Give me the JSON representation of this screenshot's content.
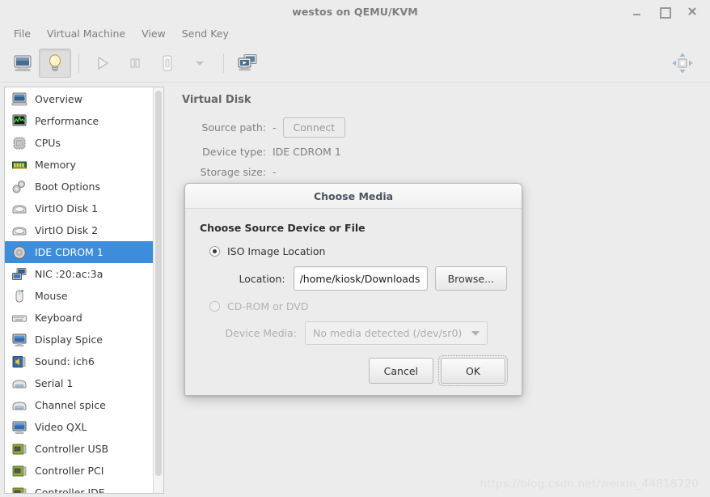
{
  "window": {
    "title": "westos on QEMU/KVM",
    "buttons": {
      "minimize": "–",
      "maximize": "□",
      "close": "✕"
    }
  },
  "menubar": {
    "items": [
      {
        "label": "File",
        "name": "menu-file"
      },
      {
        "label": "Virtual Machine",
        "name": "menu-virtual-machine"
      },
      {
        "label": "View",
        "name": "menu-view"
      },
      {
        "label": "Send Key",
        "name": "menu-send-key"
      }
    ]
  },
  "toolbar": {
    "buttons": [
      {
        "name": "show-console-button",
        "icon": "monitor-icon",
        "pressed": false
      },
      {
        "name": "show-details-button",
        "icon": "lightbulb-icon",
        "pressed": true
      },
      {
        "name": "run-button",
        "icon": "play-icon",
        "pressed": false
      },
      {
        "name": "pause-button",
        "icon": "pause-icon",
        "pressed": false
      },
      {
        "name": "shutdown-button",
        "icon": "power-icon",
        "pressed": false
      },
      {
        "name": "shutdown-menu-button",
        "icon": "chevron-down-icon",
        "pressed": false
      },
      {
        "name": "snapshots-button",
        "icon": "screens-icon",
        "pressed": false
      }
    ],
    "right_button": {
      "name": "fullscreen-button",
      "icon": "resize-icon"
    }
  },
  "sidebar": {
    "selected_index": 7,
    "items": [
      {
        "label": "Overview",
        "icon": "computer-icon"
      },
      {
        "label": "Performance",
        "icon": "chart-monitor-icon"
      },
      {
        "label": "CPUs",
        "icon": "cpu-chip-icon"
      },
      {
        "label": "Memory",
        "icon": "memory-stick-icon"
      },
      {
        "label": "Boot Options",
        "icon": "gears-icon"
      },
      {
        "label": "VirtIO Disk 1",
        "icon": "hard-disk-icon"
      },
      {
        "label": "VirtIO Disk 2",
        "icon": "hard-disk-icon"
      },
      {
        "label": "IDE CDROM 1",
        "icon": "cdrom-disc-icon"
      },
      {
        "label": "NIC :20:ac:3a",
        "icon": "network-icon"
      },
      {
        "label": "Mouse",
        "icon": "mouse-icon"
      },
      {
        "label": "Keyboard",
        "icon": "keyboard-icon"
      },
      {
        "label": "Display Spice",
        "icon": "display-icon"
      },
      {
        "label": "Sound: ich6",
        "icon": "sound-card-icon"
      },
      {
        "label": "Serial 1",
        "icon": "serial-port-icon"
      },
      {
        "label": "Channel spice",
        "icon": "serial-port-icon"
      },
      {
        "label": "Video QXL",
        "icon": "display-icon"
      },
      {
        "label": "Controller USB",
        "icon": "pci-card-icon"
      },
      {
        "label": "Controller PCI",
        "icon": "pci-card-icon"
      },
      {
        "label": "Controller IDE",
        "icon": "pci-card-icon"
      }
    ]
  },
  "main": {
    "panel_title": "Virtual Disk",
    "fields": [
      {
        "label": "Source path:",
        "value": "-",
        "has_button": true,
        "button_label": "Connect"
      },
      {
        "label": "Device type:",
        "value": "IDE CDROM 1",
        "has_button": false
      },
      {
        "label": "Storage size:",
        "value": "-",
        "has_button": false
      }
    ]
  },
  "dialog": {
    "title": "Choose Media",
    "heading": "Choose Source Device or File",
    "iso_option": {
      "label": "ISO Image Location",
      "checked": true,
      "disabled": false
    },
    "location": {
      "label": "Location:",
      "value": "/home/kiosk/Downloads",
      "browse_label": "Browse..."
    },
    "cdrom_option": {
      "label": "CD-ROM or DVD",
      "checked": false,
      "disabled": true
    },
    "device_media": {
      "label": "Device Media:",
      "selected": "No media detected (/dev/sr0)",
      "disabled": true
    },
    "actions": {
      "cancel_label": "Cancel",
      "ok_label": "OK"
    }
  },
  "watermark": {
    "text": "https://blog.csdn.net/weixin_44818720"
  },
  "colors": {
    "window_bg": "#ececec",
    "selection_blue": "#3c8ddc",
    "list_bg": "#ffffff",
    "text_primary": "#3a3a3a",
    "text_muted": "#808080",
    "dialog_title_text": "#4a5560"
  }
}
